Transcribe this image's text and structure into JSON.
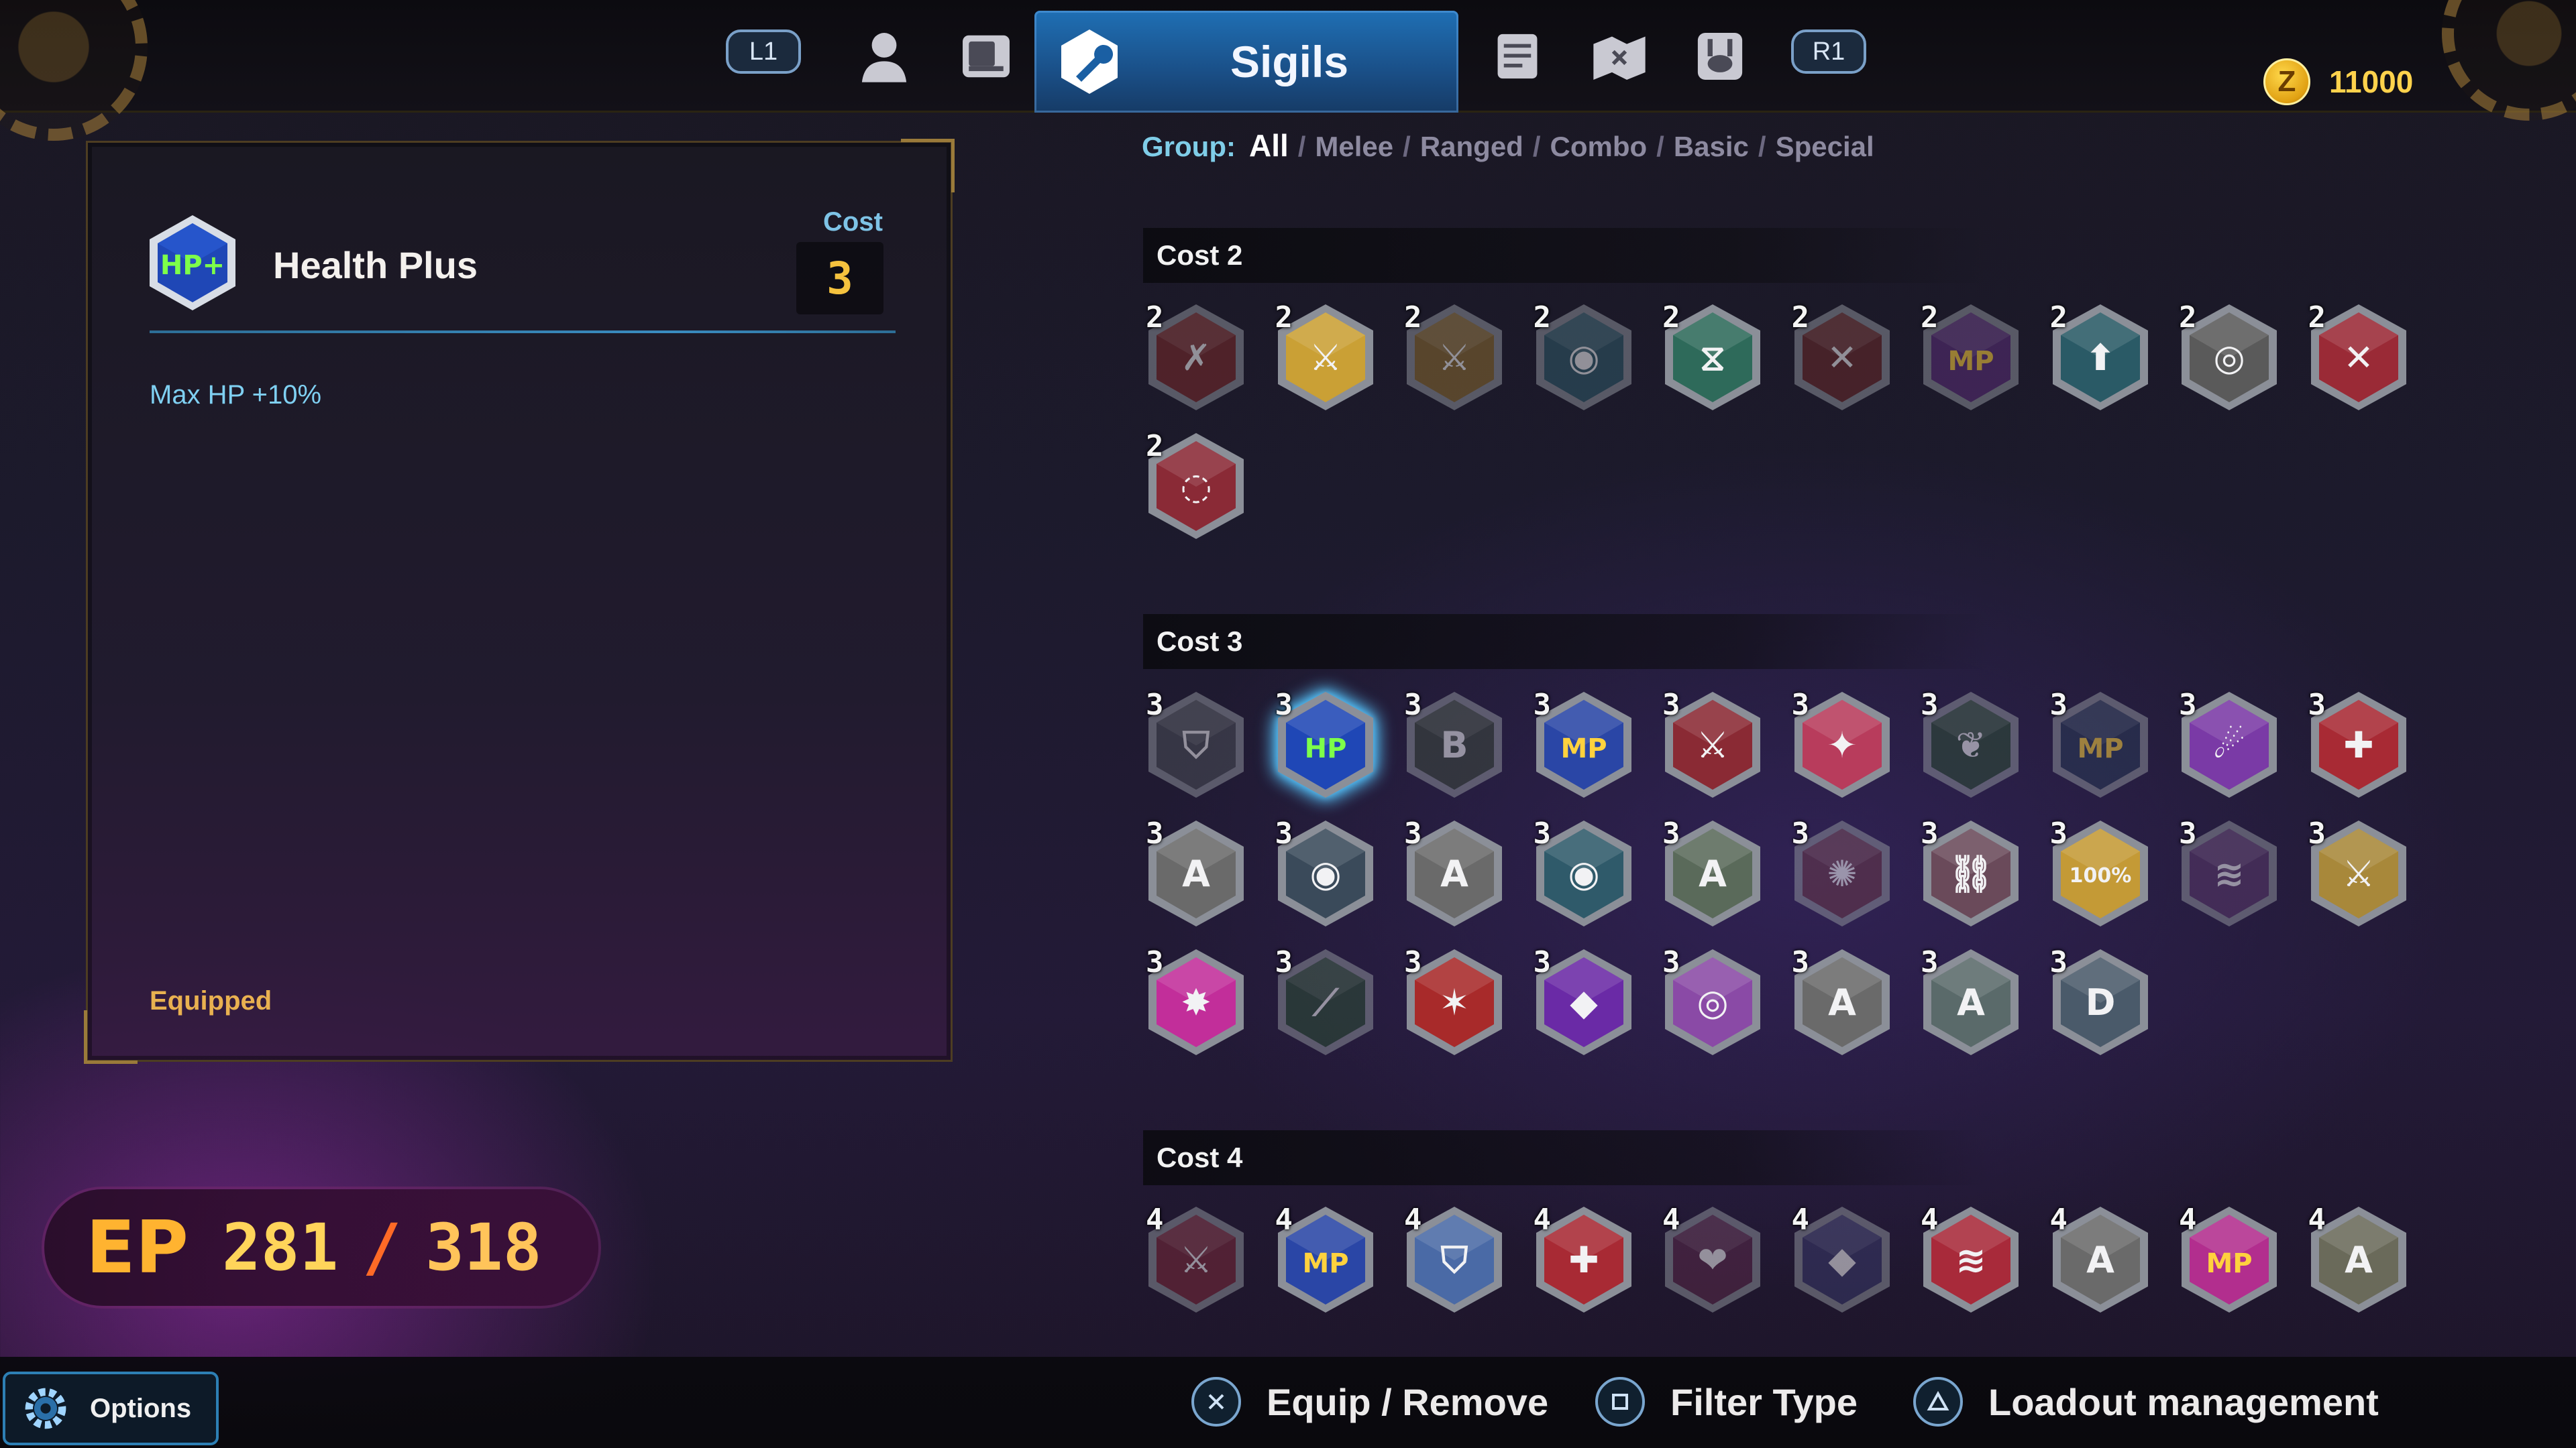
{
  "top_nav": {
    "left_shoulder": "L1",
    "right_shoulder": "R1",
    "active_tab": "Sigils",
    "icons": [
      "character-icon",
      "weapon-icon",
      "sigil-wrench-icon",
      "scroll-icon",
      "map-icon",
      "bunny-icon"
    ]
  },
  "currency": {
    "icon": "z-coin-icon",
    "symbol": "Z",
    "amount": "11000"
  },
  "detail": {
    "icon_text": "HP+",
    "name": "Health Plus",
    "cost_label": "Cost",
    "cost_value": "3",
    "description": "Max HP +10%",
    "status": "Equipped"
  },
  "filter": {
    "label": "Group:",
    "options": [
      "All",
      "Melee",
      "Ranged",
      "Combo",
      "Basic",
      "Special"
    ],
    "active": "All",
    "separator": "/"
  },
  "groups": [
    {
      "title": "Cost 2",
      "cost": "2",
      "sigils": [
        {
          "icon": "slash-plus-icon",
          "color": "#7a2a2a",
          "glyph": "✗",
          "dim": true
        },
        {
          "icon": "sword-shield-icon",
          "color": "#caa035",
          "glyph": "⚔"
        },
        {
          "icon": "sword-gold-icon",
          "color": "#8a6a30",
          "glyph": "⚔",
          "dim": true
        },
        {
          "icon": "orb-slash-icon",
          "color": "#2f5a68",
          "glyph": "◉",
          "dim": true
        },
        {
          "icon": "hourglass-sword-icon",
          "color": "#2e6a5a",
          "glyph": "⧖"
        },
        {
          "icon": "cancel-icon",
          "color": "#6a2a2a",
          "glyph": "✕",
          "dim": true
        },
        {
          "icon": "mp-plus-icon",
          "color": "#5a2e78",
          "glyph": "MP",
          "dim": true
        },
        {
          "icon": "orb-up-arrow-icon",
          "color": "#2a5a66",
          "glyph": "⬆"
        },
        {
          "icon": "target-orb-icon",
          "color": "#5a5a5a",
          "glyph": "◎"
        },
        {
          "icon": "x-mark-icon",
          "color": "#9a2a36",
          "glyph": "✕"
        },
        {
          "icon": "storm-orb-icon",
          "color": "#8a2a36",
          "glyph": "◌"
        }
      ]
    },
    {
      "title": "Cost 3",
      "cost": "3",
      "sigils": [
        {
          "icon": "shield-icon",
          "color": "#4a4e56",
          "glyph": "⛉",
          "dim": true
        },
        {
          "icon": "hp-plus-icon",
          "color": "#1f47b6",
          "glyph": "HP",
          "selected": true
        },
        {
          "icon": "b-orb-icon",
          "color": "#3e4a3e",
          "glyph": "B",
          "dim": true
        },
        {
          "icon": "mp-orb-icon",
          "color": "#2a46a6",
          "glyph": "MP"
        },
        {
          "icon": "sword-plus-one-icon",
          "color": "#8a2a34",
          "glyph": "⚔"
        },
        {
          "icon": "pink-burst-icon",
          "color": "#b83c5c",
          "glyph": "✦"
        },
        {
          "icon": "leaf-icon",
          "color": "#2f4e36",
          "glyph": "❦",
          "dim": true
        },
        {
          "icon": "mp-sword-icon",
          "color": "#2a3a56",
          "glyph": "MP",
          "dim": true
        },
        {
          "icon": "purple-comet-icon",
          "color": "#7a3aa6",
          "glyph": "☄"
        },
        {
          "icon": "figure-plus-one-icon",
          "color": "#a82a34",
          "glyph": "✚"
        },
        {
          "icon": "a-sparkle-icon",
          "color": "#6a6a6a",
          "glyph": "A"
        },
        {
          "icon": "orb-plus-one-icon",
          "color": "#3a4a5a",
          "glyph": "◉"
        },
        {
          "icon": "a-wind-icon",
          "color": "#6a6a6a",
          "glyph": "A"
        },
        {
          "icon": "orb-sword-icon",
          "color": "#2f5a6a",
          "glyph": "◉"
        },
        {
          "icon": "a-star-icon",
          "color": "#5a6a5a",
          "glyph": "A"
        },
        {
          "icon": "ep-burst-icon",
          "color": "#6a3a4a",
          "glyph": "✺",
          "dim": true
        },
        {
          "icon": "chains-icon",
          "color": "#6a4a5a",
          "glyph": "⛓"
        },
        {
          "icon": "hundred-percent-icon",
          "color": "#c49a36",
          "glyph": "100%"
        },
        {
          "icon": "purple-streak-icon",
          "color": "#5a3a6a",
          "glyph": "≋",
          "dim": true
        },
        {
          "icon": "gold-sword-plus-icon",
          "color": "#a8883a",
          "glyph": "⚔"
        },
        {
          "icon": "magenta-burst-icon",
          "color": "#c22e9a",
          "glyph": "✸"
        },
        {
          "icon": "green-blade-icon",
          "color": "#2e4e36",
          "glyph": "⟋",
          "dim": true
        },
        {
          "icon": "red-figure-icon",
          "color": "#a82a2a",
          "glyph": "✶"
        },
        {
          "icon": "purple-gem-icon",
          "color": "#6a2aa6",
          "glyph": "◆"
        },
        {
          "icon": "golden-ring-icon",
          "color": "#8a4aa6",
          "glyph": "◎"
        },
        {
          "icon": "a-arrow-icon",
          "color": "#6a6a6a",
          "glyph": "A"
        },
        {
          "icon": "a-cross-icon",
          "color": "#5a6a6a",
          "glyph": "A"
        },
        {
          "icon": "d-circle-icon",
          "color": "#4a5a6a",
          "glyph": "D"
        }
      ]
    },
    {
      "title": "Cost 4",
      "cost": "4",
      "sigils": [
        {
          "icon": "crossed-swords-icon",
          "color": "#7a2a3a",
          "glyph": "⚔",
          "dim": true
        },
        {
          "icon": "mp-ten-icon",
          "color": "#2a46a6",
          "glyph": "MP"
        },
        {
          "icon": "blue-shield-icon",
          "color": "#4a6aa6",
          "glyph": "⛉"
        },
        {
          "icon": "figure-plus-three-icon",
          "color": "#a82a34",
          "glyph": "✚"
        },
        {
          "icon": "red-hearts-icon",
          "color": "#5a2a4a",
          "glyph": "❤",
          "dim": true
        },
        {
          "icon": "blue-diamonds-icon",
          "color": "#3a3a6a",
          "glyph": "◆",
          "dim": true
        },
        {
          "icon": "blue-streak-icon",
          "color": "#a82a3a",
          "glyph": "≋"
        },
        {
          "icon": "a-hammer-icon",
          "color": "#6a6a6a",
          "glyph": "A"
        },
        {
          "icon": "mp-pink-icon",
          "color": "#b22e8e",
          "glyph": "MP"
        },
        {
          "icon": "a-gold-sword-icon",
          "color": "#6a6a5a",
          "glyph": "A"
        }
      ]
    }
  ],
  "options_button": {
    "icon": "gear-icon",
    "label": "Options"
  },
  "ep": {
    "label": "EP",
    "current": "281",
    "separator": "/",
    "max": "318"
  },
  "hints": [
    {
      "icon": "cross-button-icon",
      "label": "Equip / Remove"
    },
    {
      "icon": "square-button-icon",
      "label": "Filter Type"
    },
    {
      "icon": "triangle-button-icon",
      "label": "Loadout management"
    }
  ]
}
